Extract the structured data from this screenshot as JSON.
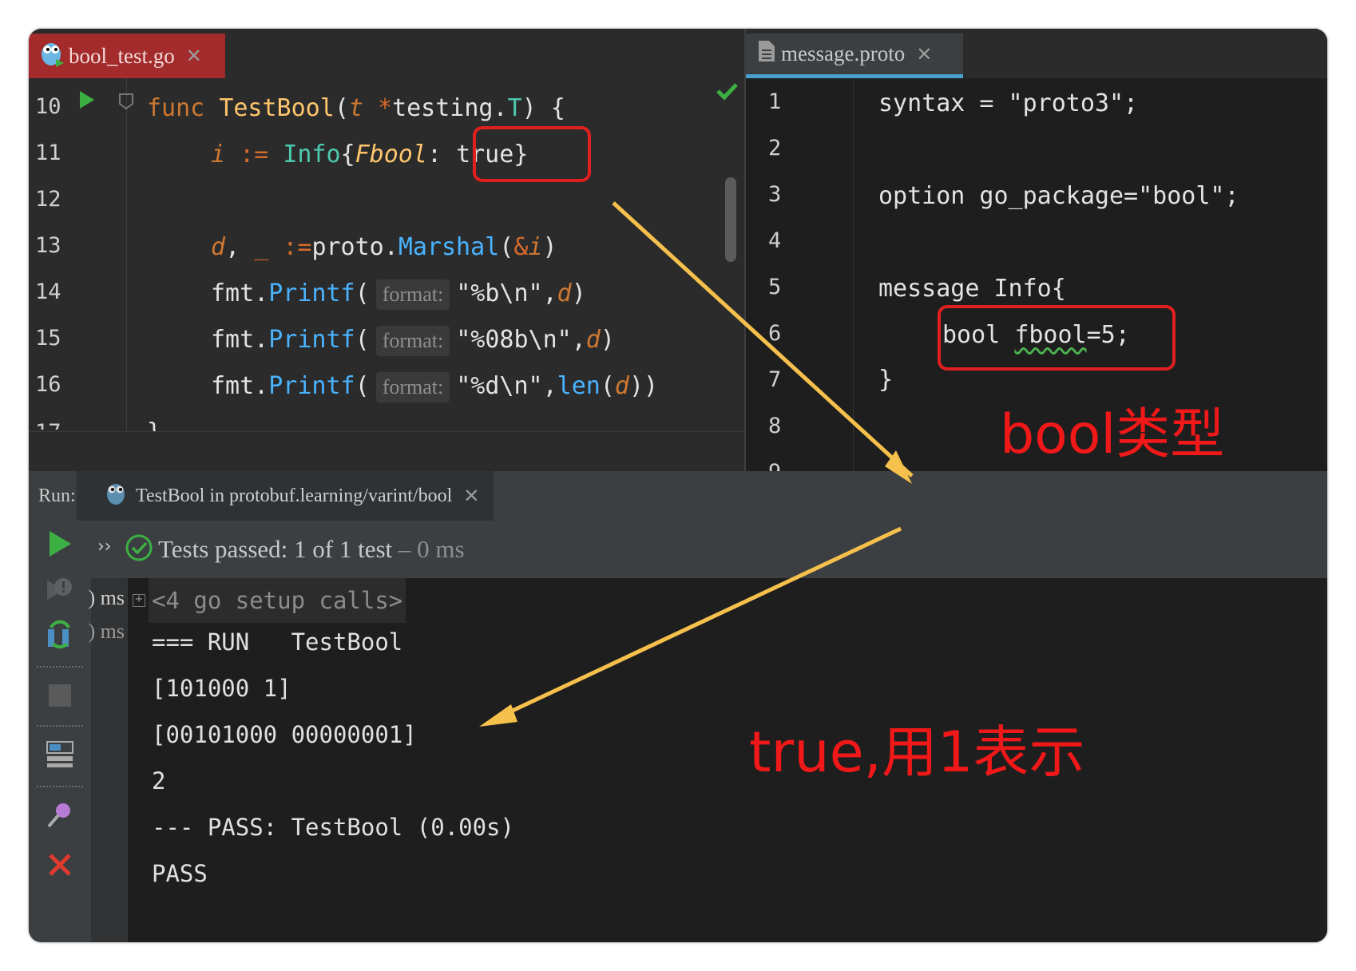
{
  "left_editor": {
    "tab_label": "bool_test.go",
    "tab_close": "✕",
    "lines": [
      {
        "num": "10"
      },
      {
        "num": "11"
      },
      {
        "num": "12"
      },
      {
        "num": "13"
      },
      {
        "num": "14"
      },
      {
        "num": "15"
      },
      {
        "num": "16"
      },
      {
        "num": "17"
      }
    ],
    "code": {
      "l10_func": "func",
      "l10_name": "TestBool",
      "l10_open": "(",
      "l10_param": "t",
      "l10_star": "*",
      "l10_pkg": "testing.",
      "l10_type": "T",
      "l10_close": ") {",
      "l11_var": "i",
      "l11_assign": ":=",
      "l11_type": "Info",
      "l11_brace": "{",
      "l11_field": "Fbool",
      "l11_colon": ":",
      "l11_value": "true}",
      "l13_var": "d",
      "l13_comma": ", ",
      "l13_blank": "_",
      "l13_assign": ":=",
      "l13_pkg": "proto.",
      "l13_method": "Marshal",
      "l13_args_open": "(",
      "l13_amp": "&",
      "l13_arg": "i",
      "l13_args_close": ")",
      "printf_pkg": "fmt.",
      "printf_method": "Printf",
      "paren_open": "(",
      "hint": "format:",
      "l14_str": "\"%b\\n\"",
      "l15_str": "\"%08b\\n\"",
      "l16_str": "\"%d\\n\"",
      "comma": ",",
      "arg_d": "d",
      "paren_close": ")",
      "len_fn": "len",
      "l16_tail": "))",
      "l17_partial": "}"
    }
  },
  "right_editor": {
    "tab_label": "message.proto",
    "tab_close": "✕",
    "line_numbers": [
      "1",
      "2",
      "3",
      "4",
      "5",
      "6",
      "7",
      "8",
      "9"
    ],
    "lines": {
      "l1": "syntax = \"proto3\";",
      "l3": "option go_package=\"bool\";",
      "l5": "message Info{",
      "l6_type": "bool ",
      "l6_field": "fbool",
      "l6_rest": "=5;",
      "l7": "}"
    }
  },
  "run_panel": {
    "label": "Run:",
    "tab_label": "TestBool in protobuf.learning/varint/bool",
    "tab_close": "✕",
    "status_label": "Tests passed:",
    "status_count": "1 of 1 test",
    "status_time": "– 0 ms",
    "more_glyph": "››",
    "tree_times": [
      ") ms",
      ") ms"
    ],
    "console": [
      "<4 go setup calls>",
      "=== RUN   TestBool",
      "[101000 1]",
      "[00101000 00000001]",
      "2",
      "--- PASS: TestBool (0.00s)",
      "PASS"
    ]
  },
  "annotations": {
    "top": "bool类型",
    "bottom": "true,用1表示"
  },
  "colors": {
    "annotation": "#f01818",
    "arrow": "#f6c04d",
    "highlight_box": "#e02020"
  }
}
